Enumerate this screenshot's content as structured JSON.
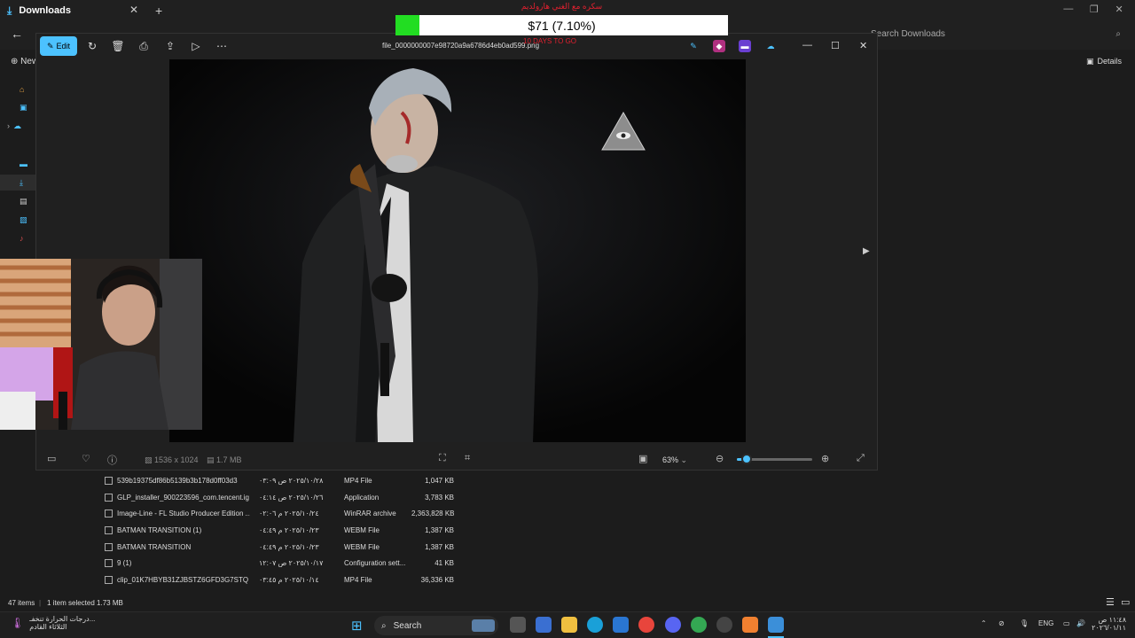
{
  "explorer": {
    "tab_title": "Downloads",
    "search_placeholder": "Search Downloads",
    "new_label": "New",
    "details_label": "Details",
    "files": [
      {
        "name": "539b19375df86b5139b3b178d0ff03d3",
        "date": "٢٠٢٥/١٠/٢٨ ص ٠٣:٠٩",
        "type": "MP4 File",
        "size": "1,047 KB"
      },
      {
        "name": "GLP_installer_900223596_com.tencent.ig",
        "date": "٢٠٢٥/١٠/٢٦ ص ٠٤:١٤",
        "type": "Application",
        "size": "3,783 KB"
      },
      {
        "name": "Image-Line - FL Studio Producer Edition ...",
        "date": "٢٠٢٥/١٠/٢٤ م ٠٢:٠٦",
        "type": "WinRAR archive",
        "size": "2,363,828 KB"
      },
      {
        "name": "BATMAN TRANSITION (1)",
        "date": "٢٠٢٥/١٠/٢٣ م ٠٤:٤٩",
        "type": "WEBM File",
        "size": "1,387 KB"
      },
      {
        "name": "BATMAN TRANSITION",
        "date": "٢٠٢٥/١٠/٢٣ م ٠٤:٤٩",
        "type": "WEBM File",
        "size": "1,387 KB"
      },
      {
        "name": "9 (1)",
        "date": "٢٠٢٥/١٠/١٧ ص ١٢:٠٧",
        "type": "Configuration sett...",
        "size": "41 KB"
      },
      {
        "name": "clip_01K7HBYB31ZJBSTZ6GFD3G7STQ",
        "date": "٢٠٢٥/١٠/١٤ م ٠٣:٤٥",
        "type": "MP4 File",
        "size": "36,336 KB"
      }
    ],
    "status_items": "47 items",
    "status_selected": "1 item selected  1.73 MB"
  },
  "photos": {
    "edit_label": "Edit",
    "filename": "file_0000000007e98720a9a6786d4eb0ad599.png",
    "dimensions": "1536 x 1024",
    "filesize": "1.7 MB",
    "zoom": "63%",
    "zoom_level_fraction": 0.12
  },
  "overlay": {
    "donation_title": "سكره مع الغني هارولديم",
    "donation_amount": "$71 (7.10%)",
    "donation_progress_fraction": 0.071,
    "days_text": "10 DAYS TO GO",
    "colors": {
      "bar_fill": "#22dd22",
      "text_red": "#e0202f"
    }
  },
  "taskbar": {
    "weather_line1": "درجات الحرارة تنخفـ...",
    "weather_line2": "الثلاثاء القادم",
    "search_label": "Search",
    "lang": "ENG",
    "time": "١١:٤٨ ص",
    "date": "٢٠٢٦/٠١/١١"
  },
  "colors": {
    "accent": "#4cc2ff",
    "bg": "#202020"
  }
}
